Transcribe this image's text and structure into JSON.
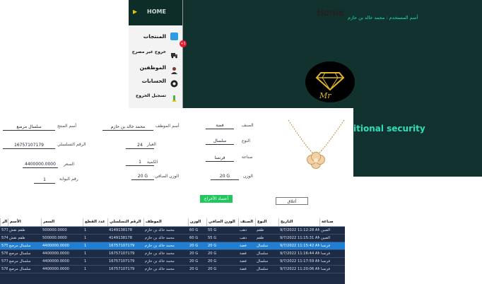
{
  "main_window": {
    "title": "Home",
    "user_line": "أسم المستخدم :  محمد خالد بن حازم",
    "ops_text": "itional security"
  },
  "sidebar": {
    "home": "HOME",
    "items": [
      {
        "label": "المنتجات",
        "icon": "products-icon",
        "color": "#2d9be6"
      },
      {
        "label": "خروج غير مصرح",
        "icon": "truck-icon",
        "color": "#333333"
      },
      {
        "label": "الموظفين",
        "icon": "employee-icon",
        "color": "#7a3b2a"
      },
      {
        "label": "الحسابات",
        "icon": "accounts-icon",
        "color": "#222222"
      },
      {
        "label": "تسجيل الخروج",
        "icon": "logout-icon",
        "color": "#4caf50"
      }
    ],
    "badge": "+1"
  },
  "form": {
    "product_name": {
      "label": "أسم المنتج",
      "value": "سلسال مرصع"
    },
    "serial": {
      "label": "الرقم التسلسلي",
      "value": "16757107179"
    },
    "price": {
      "label": "السعر",
      "value": "4400000.0000"
    },
    "gate": {
      "label": "رقم البوابة",
      "value": "1"
    },
    "employee": {
      "label": "أسم الموظف",
      "value": "محمد خالد بن حازم"
    },
    "caliber": {
      "label": "العيار",
      "value": "24"
    },
    "quantity": {
      "label": "الكمية",
      "value": "1"
    },
    "net_weight": {
      "label": "الوزن الصافي",
      "value": "20 G"
    },
    "category": {
      "label": "الصنف",
      "value": "فضة"
    },
    "type": {
      "label": "النوع",
      "value": "سلسال"
    },
    "make": {
      "label": "صناعة",
      "value": "فرنسا"
    },
    "weight": {
      "label": "الوزن",
      "value": "20 G"
    },
    "save_button": "أعتماد الأخراج",
    "close_button": "أغلاق"
  },
  "grid": {
    "columns": [
      "صناعة",
      "التاريخ",
      "النوع",
      "الصنف",
      "الوزن الصافي",
      "الوزن",
      "الموظف",
      "الرقم التسلسلي",
      "عدد القطع",
      "السعر",
      "الأسم",
      "الر"
    ],
    "rows": [
      [
        "الصين",
        "9/7/2022 11:12:28 AM",
        "طقم",
        "ذهب",
        "55 G",
        "60 G",
        "محمد خالد بن حازم",
        "4149138178",
        "1",
        "500000.0000",
        "طقم نقش",
        "573"
      ],
      [
        "الصين",
        "9/7/2022 11:15:31 AM",
        "طقم",
        "ذهب",
        "55 G",
        "60 G",
        "محمد خالد بن حازم",
        "4149138178",
        "1",
        "500000.0000",
        "طقم نقش",
        "574"
      ],
      [
        "فرنسا",
        "9/7/2022 11:15:42 AM",
        "سلسال",
        "فضة",
        "20 G",
        "20 G",
        "محمد خالد بن حازم",
        "16757107179",
        "1",
        "4400000.0000",
        "سلسال مرصع",
        "575"
      ],
      [
        "فرنسا",
        "9/7/2022 11:16:44 AM",
        "سلسال",
        "فضة",
        "20 G",
        "20 G",
        "محمد خالد بن حازم",
        "16757107179",
        "1",
        "4400000.0000",
        "سلسال مرصع",
        "576"
      ],
      [
        "فرنسا",
        "9/7/2022 11:17:59 AM",
        "سلسال",
        "فضة",
        "20 G",
        "20 G",
        "محمد خالد بن حازم",
        "16757107179",
        "1",
        "4400000.0000",
        "سلسال مرصع",
        "577"
      ],
      [
        "فرنسا",
        "9/7/2022 11:20:06 AM",
        "سلسال",
        "فضة",
        "20 G",
        "20 G",
        "محمد خالد بن حازم",
        "16757107179",
        "1",
        "4400000.0000",
        "سلسال مرصع",
        "578"
      ]
    ],
    "selected_row": 2
  },
  "colors": {
    "dark_bg": "#12322f",
    "accent": "#18e3b0",
    "grid_bg": "#1d2b45",
    "selected": "#1e7fd4",
    "green_button": "#22c55e"
  }
}
